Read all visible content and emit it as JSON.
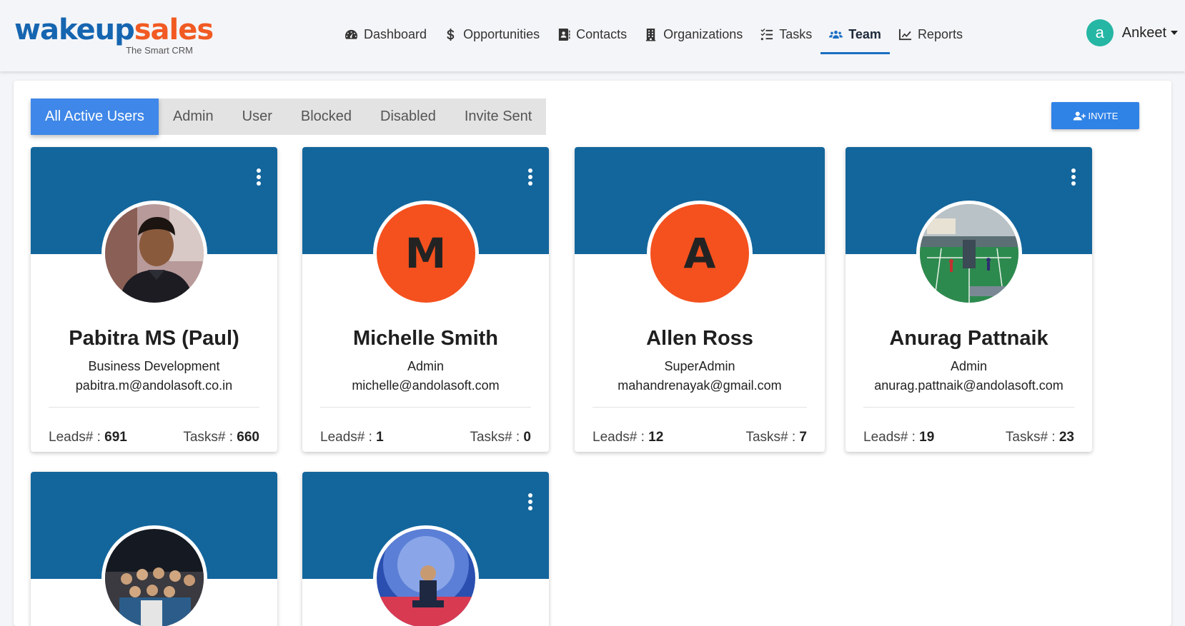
{
  "header": {
    "logo": {
      "part1": "wakeup",
      "part2": "sales",
      "tagline": "The Smart CRM"
    },
    "nav": [
      {
        "label": "Dashboard",
        "icon": "gauge-icon",
        "active": false
      },
      {
        "label": "Opportunities",
        "icon": "dollar-icon",
        "active": false
      },
      {
        "label": "Contacts",
        "icon": "address-book-icon",
        "active": false
      },
      {
        "label": "Organizations",
        "icon": "building-icon",
        "active": false
      },
      {
        "label": "Tasks",
        "icon": "tasks-icon",
        "active": false
      },
      {
        "label": "Team",
        "icon": "users-icon",
        "active": true
      },
      {
        "label": "Reports",
        "icon": "chart-line-icon",
        "active": false
      }
    ],
    "user": {
      "initial": "a",
      "name": "Ankeet"
    }
  },
  "tabs": [
    {
      "label": "All Active Users",
      "active": true
    },
    {
      "label": "Admin",
      "active": false
    },
    {
      "label": "User",
      "active": false
    },
    {
      "label": "Blocked",
      "active": false
    },
    {
      "label": "Disabled",
      "active": false
    },
    {
      "label": "Invite Sent",
      "active": false
    }
  ],
  "invite_label": "INVITE",
  "stats_labels": {
    "leads": "Leads# : ",
    "tasks": "Tasks# : "
  },
  "users": [
    {
      "name": "Pabitra MS (Paul)",
      "role": "Business Development",
      "email": "pabitra.m@andolasoft.co.in",
      "leads": "691",
      "tasks": "660",
      "avatar_type": "photo",
      "avatar_letter": "",
      "has_menu": true
    },
    {
      "name": "Michelle Smith",
      "role": "Admin",
      "email": "michelle@andolasoft.com",
      "leads": "1",
      "tasks": "0",
      "avatar_type": "letter",
      "avatar_letter": "M",
      "has_menu": true
    },
    {
      "name": "Allen Ross",
      "role": "SuperAdmin",
      "email": "mahandrenayak@gmail.com",
      "leads": "12",
      "tasks": "7",
      "avatar_type": "letter",
      "avatar_letter": "A",
      "has_menu": false
    },
    {
      "name": "Anurag Pattnaik",
      "role": "Admin",
      "email": "anurag.pattnaik@andolasoft.com",
      "leads": "19",
      "tasks": "23",
      "avatar_type": "photo",
      "avatar_letter": "",
      "has_menu": true
    },
    {
      "name": "",
      "role": "",
      "email": "",
      "leads": "",
      "tasks": "",
      "avatar_type": "photo",
      "avatar_letter": "",
      "has_menu": false
    },
    {
      "name": "",
      "role": "",
      "email": "",
      "leads": "",
      "tasks": "",
      "avatar_type": "photo",
      "avatar_letter": "",
      "has_menu": true
    }
  ],
  "colors": {
    "brand_blue": "#1565b0",
    "brand_orange": "#f15a22",
    "card_banner": "#13669c",
    "accent": "#3f87e8",
    "avatar_letter_bg": "#f4511e",
    "user_avatar": "#26b6a4"
  }
}
